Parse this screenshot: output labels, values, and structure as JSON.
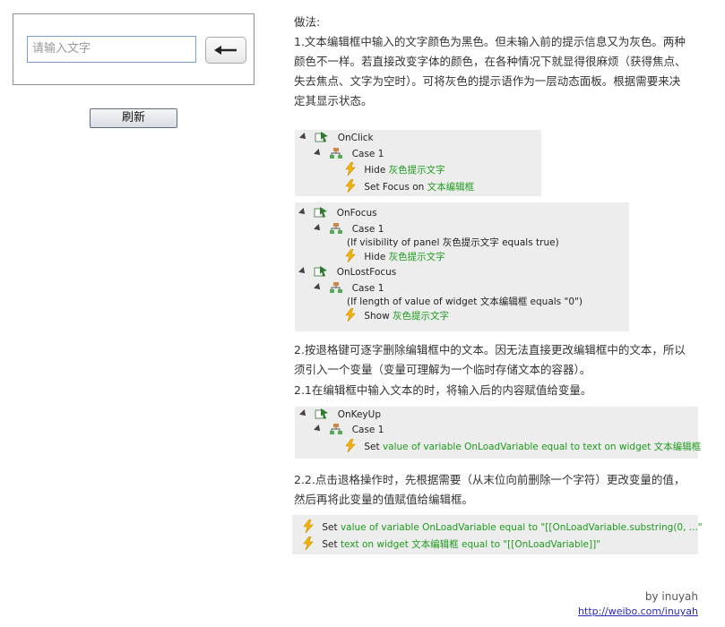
{
  "demo": {
    "input_placeholder": "请输入文字",
    "refresh_label": "刷新"
  },
  "notes": {
    "method_title": "做法:",
    "p1": "1.文本编辑框中输入的文字颜色为黑色。但未输入前的提示信息又为灰色。两种颜色不一样。若直接改变字体的颜色，在各种情况下就显得很麻烦（获得焦点、失去焦点、文字为空时）。可将灰色的提示语作为一层动态面板。根据需要来决定其显示状态。",
    "p2": "2.按退格键可逐字删除编辑框中的文本。因无法直接更改编辑框中的文本，所以须引入一个变量（变量可理解为一个临时存储文本的容器）。",
    "p21": "2.1在编辑框中输入文本的时，将输入后的内容赋值给变量。",
    "p22": "2.2.点击退格操作时，先根据需要（从末位向前删除一个字符）更改变量的值，然后再将此变量的值赋值给编辑框。"
  },
  "panels": {
    "onclick": {
      "event": "OnClick",
      "case": "Case 1",
      "a1_verb": "Hide",
      "a1_target": "灰色提示文字",
      "a2_verb": "Set Focus on",
      "a2_target": "文本编辑框"
    },
    "onfocus": {
      "event": "OnFocus",
      "case": "Case 1",
      "condition": "(If visibility of panel 灰色提示文字 equals true)",
      "a1_verb": "Hide",
      "a1_target": "灰色提示文字",
      "event2": "OnLostFocus",
      "case2": "Case 1",
      "condition2": "(If length of value of widget 文本编辑框 equals \"0\")",
      "a2_verb": "Show",
      "a2_target": "灰色提示文字"
    },
    "onkeyup": {
      "event": "OnKeyUp",
      "case": "Case 1",
      "a1_verb": "Set",
      "a1_target": "value of variable OnLoadVariable equal to text on widget 文本编辑框"
    },
    "backspace": {
      "a1_verb": "Set",
      "a1_target": "value of variable OnLoadVariable equal to \"[[OnLoadVariable.substring(0, ...\"",
      "a2_verb": "Set",
      "a2_target": "text on widget 文本编辑框 equal to \"[[OnLoadVariable]]\""
    }
  },
  "footer": {
    "by": "by inuyah",
    "link": "http://weibo.com/inuyah"
  },
  "colors": {
    "action_target": "#1d9a1d",
    "panel_bg": "#ededed",
    "link": "#2a2ab5"
  }
}
